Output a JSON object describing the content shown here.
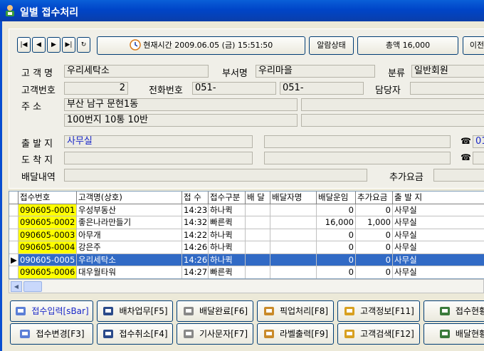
{
  "window": {
    "title": "일별 접수처리"
  },
  "toolbar": {
    "nav_first": "|◀",
    "nav_prev": "◀",
    "nav_next": "▶",
    "nav_last": "▶|",
    "refresh": "↻",
    "clock_label": "현재시간 2009.06.05 (금) 15:51:50",
    "alarm_label": "알람상태",
    "total_label": "총액 16,000",
    "prev_label": "이전"
  },
  "form": {
    "customer_name_label": "고 객 명",
    "customer_name": "우리세탁소",
    "dept_label": "부서명",
    "dept": "우리마을",
    "class_label": "분류",
    "class": "일반회원",
    "customer_no_label": "고객번호",
    "customer_no": "2",
    "phone_label": "전화번호",
    "phone1": "051-",
    "phone2": "051-",
    "manager_label": "담당자",
    "manager": "",
    "address_label": "주    소",
    "address1": "부산 남구 문현1동",
    "address2": "100번지 10통 10반",
    "origin_label": "출 발 지",
    "origin": "사무실",
    "origin_phone_prefix": "01",
    "dest_label": "도 착 지",
    "delivery_label": "배달내역",
    "extra_fee_label": "추가요금"
  },
  "grid": {
    "columns": [
      "접수번호",
      "고객명(상호)",
      "접 수",
      "접수구분",
      "배 달",
      "배달자명",
      "배달운임",
      "추가요금",
      "출 발 지"
    ],
    "rows": [
      {
        "id": "090605-0001",
        "name": "우성부동산",
        "time": "14:23",
        "type": "하나퀵",
        "deliv": "",
        "driver": "",
        "fare": "0",
        "extra": "0",
        "origin": "사무실",
        "selected": false
      },
      {
        "id": "090605-0002",
        "name": "좋은나라만들기",
        "time": "14:32",
        "type": "빠른퀵",
        "deliv": "",
        "driver": "",
        "fare": "16,000",
        "extra": "1,000",
        "origin": "사무실",
        "selected": false
      },
      {
        "id": "090605-0003",
        "name": "아무개",
        "time": "14:22",
        "type": "하나퀵",
        "deliv": "",
        "driver": "",
        "fare": "0",
        "extra": "0",
        "origin": "사무실",
        "selected": false
      },
      {
        "id": "090605-0004",
        "name": "강은주",
        "time": "14:26",
        "type": "하나퀵",
        "deliv": "",
        "driver": "",
        "fare": "0",
        "extra": "0",
        "origin": "사무실",
        "selected": false
      },
      {
        "id": "090605-0005",
        "name": "우리세탁소",
        "time": "14:26",
        "type": "하나퀵",
        "deliv": "",
        "driver": "",
        "fare": "0",
        "extra": "0",
        "origin": "사무실",
        "selected": true
      },
      {
        "id": "090605-0006",
        "name": "대우월타워",
        "time": "14:27",
        "type": "빠른퀵",
        "deliv": "",
        "driver": "",
        "fare": "0",
        "extra": "0",
        "origin": "사무실",
        "selected": false
      }
    ]
  },
  "actions": {
    "row1": [
      "접수입력[sBar]",
      "배차업무[F5]",
      "배달완료[F6]",
      "픽업처리[F8]",
      "고객정보[F11]",
      "접수현황"
    ],
    "row2": [
      "접수변경[F3]",
      "접수취소[F4]",
      "기사문자[F7]",
      "라벨출력[F9]",
      "고객검색[F12]",
      "배달현황"
    ]
  },
  "colors": {
    "highlight_id": "#ffff00",
    "selected_row": "#316ac5",
    "field_text_blue": "#1a28c8"
  }
}
